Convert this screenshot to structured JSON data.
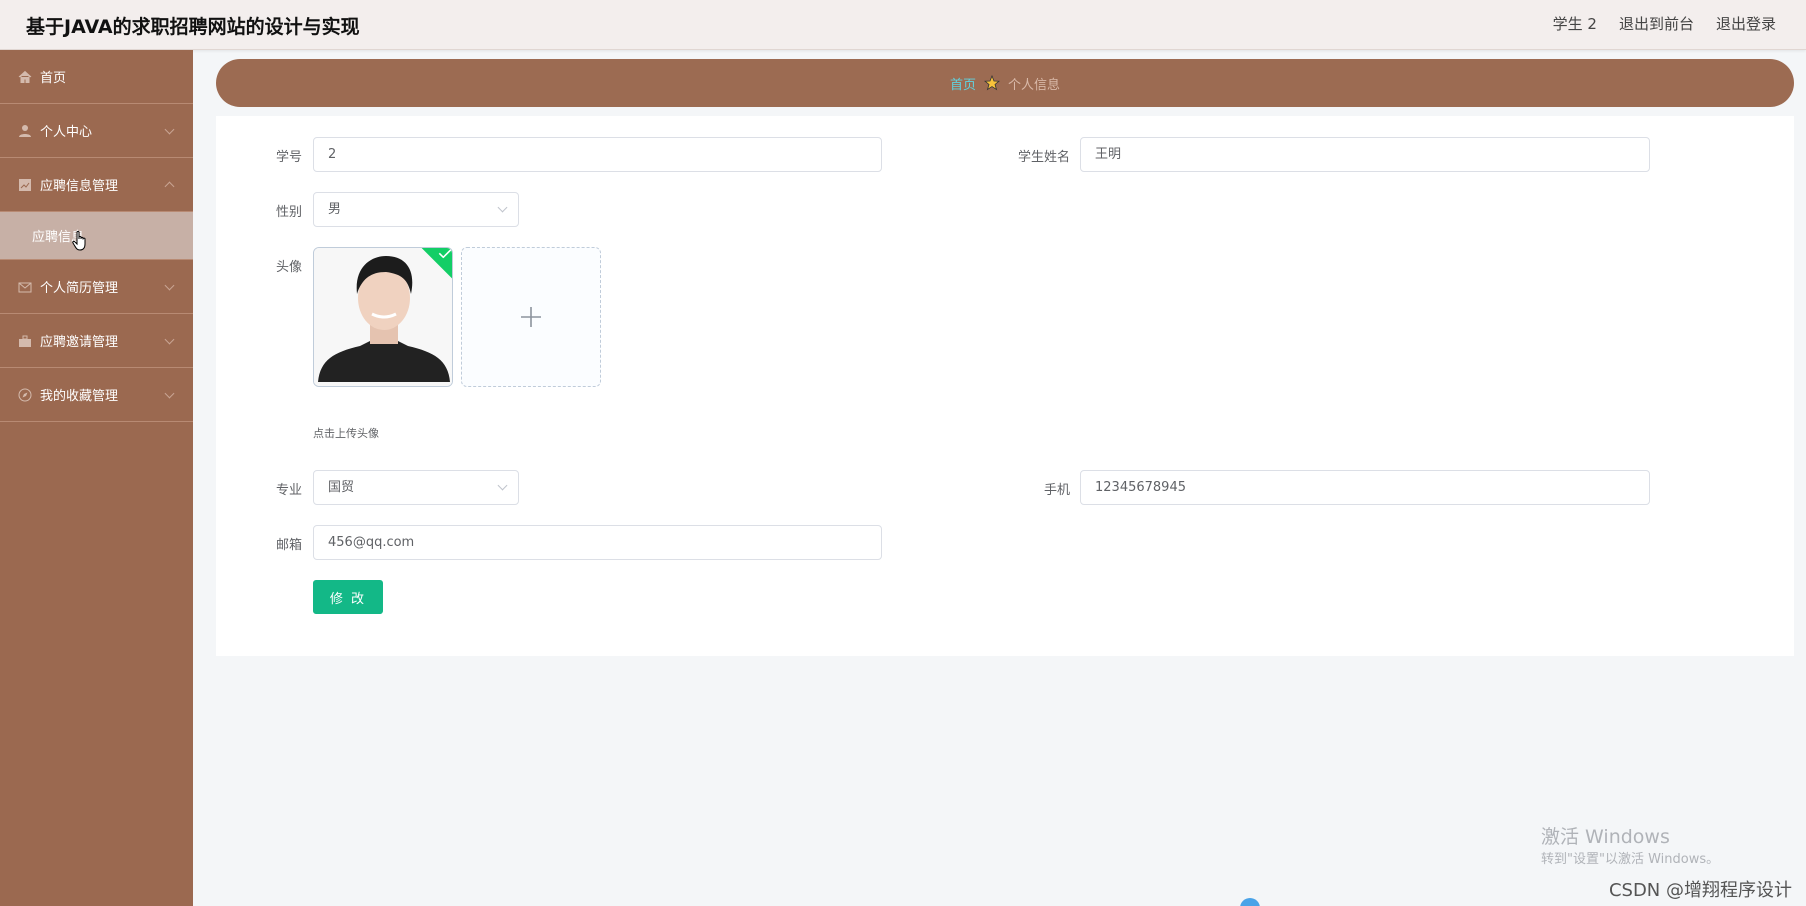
{
  "header": {
    "title": "基于JAVA的求职招聘网站的设计与实现",
    "user": "学生 2",
    "front_link": "退出到前台",
    "logout_link": "退出登录"
  },
  "sidebar": {
    "items": [
      {
        "label": "首页",
        "icon": "home-icon"
      },
      {
        "label": "个人中心",
        "icon": "user-icon"
      },
      {
        "label": "应聘信息管理",
        "icon": "document-icon",
        "expanded": true
      },
      {
        "label": "个人简历管理",
        "icon": "mail-icon"
      },
      {
        "label": "应聘邀请管理",
        "icon": "briefcase-icon"
      },
      {
        "label": "我的收藏管理",
        "icon": "compass-icon"
      }
    ],
    "sub_item": "应聘信息"
  },
  "breadcrumb": {
    "home": "首页",
    "current": "个人信息"
  },
  "form": {
    "student_id_label": "学号",
    "student_id_value": "2",
    "name_label": "学生姓名",
    "name_value": "王明",
    "gender_label": "性别",
    "gender_value": "男",
    "avatar_label": "头像",
    "upload_hint": "点击上传头像",
    "major_label": "专业",
    "major_value": "国贸",
    "phone_label": "手机",
    "phone_value": "12345678945",
    "email_label": "邮箱",
    "email_value": "456@qq.com",
    "submit_label": "修 改"
  },
  "watermark": {
    "line1": "激活 Windows",
    "line2": "转到\"设置\"以激活 Windows。",
    "csdn": "CSDN @增翔程序设计"
  },
  "colors": {
    "sidebar": "#9b6950",
    "breadcrumb": "#9c6b52",
    "button": "#13b887",
    "badge": "#13ce66"
  }
}
